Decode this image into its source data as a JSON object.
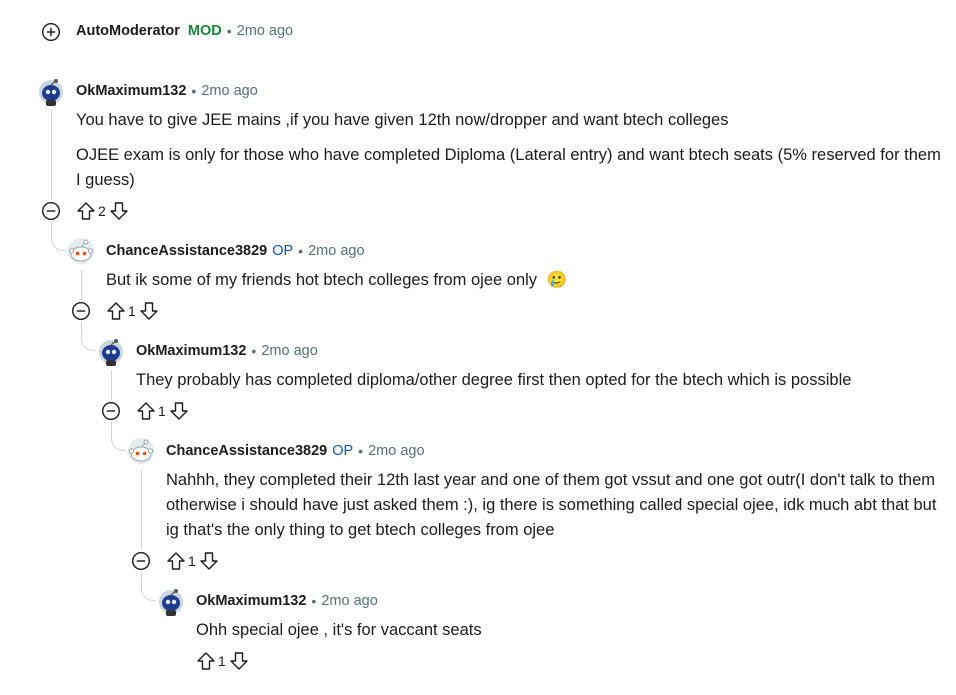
{
  "top": {
    "author": "AutoModerator",
    "badge": "MOD",
    "time": "2mo ago"
  },
  "comments": [
    {
      "author": "OkMaximum132",
      "time": "2mo ago",
      "paragraphs": [
        "You have to give JEE mains ,if you have given 12th now/dropper and want btech colleges",
        "OJEE exam is only for those who have completed Diploma (Lateral entry) and want btech seats (5% reserved for them I guess)"
      ],
      "votes": "2"
    },
    {
      "author": "ChanceAssistance3829",
      "op": "OP",
      "time": "2mo ago",
      "paragraphs": [
        "But ik some of my friends hot btech colleges from ojee only"
      ],
      "emoji": "🥲",
      "votes": "1"
    },
    {
      "author": "OkMaximum132",
      "time": "2mo ago",
      "paragraphs": [
        "They probably has completed diploma/other degree first then opted for the btech which is possible"
      ],
      "votes": "1"
    },
    {
      "author": "ChanceAssistance3829",
      "op": "OP",
      "time": "2mo ago",
      "paragraphs": [
        "Nahhh, they completed their 12th last year and one of them got vssut and one got outr(I don't talk to them otherwise i should have just asked them :), ig there is something called special ojee, idk much abt that but ig that's the only thing to get btech colleges from ojee"
      ],
      "votes": "1"
    },
    {
      "author": "OkMaximum132",
      "time": "2mo ago",
      "paragraphs": [
        "Ohh special ojee , it's for vaccant seats"
      ],
      "votes": "1"
    }
  ],
  "icons": {
    "expand": "plus-circle-icon",
    "collapse": "minus-circle-icon",
    "upvote": "arrow-up-outline-icon",
    "downvote": "arrow-down-outline-icon",
    "avatar_ok": "blue-snoo-avatar-icon",
    "avatar_chance": "default-snoo-avatar-icon"
  },
  "colors": {
    "mod": "#138a36",
    "op": "#0a58c4",
    "meta": "#576f76",
    "thread_line": "#d0d7da"
  }
}
